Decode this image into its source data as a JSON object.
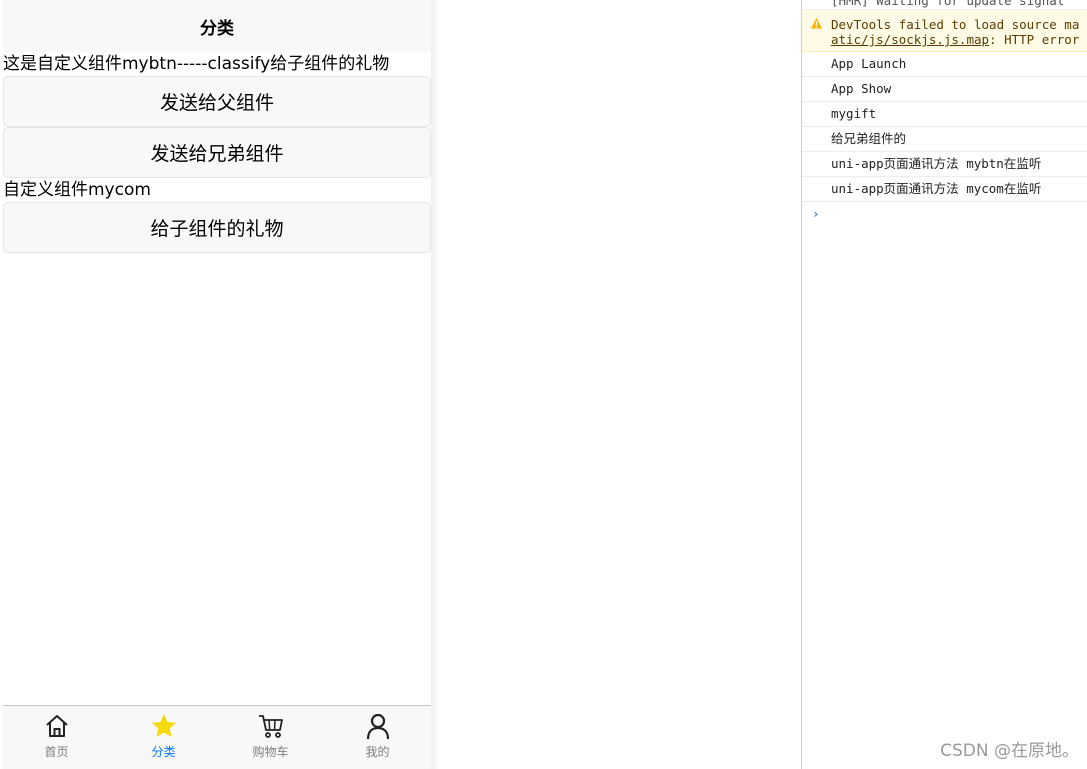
{
  "navbar": {
    "title": "分类"
  },
  "content": {
    "mybtn_text": "这是自定义组件mybtn-----classify给子组件的礼物",
    "buttons": [
      "发送给父组件",
      "发送给兄弟组件"
    ],
    "mycom_text": "自定义组件mycom",
    "gift_button": "给子组件的礼物"
  },
  "tabbar": {
    "tabs": [
      {
        "label": "首页",
        "icon": "home-icon",
        "active": false
      },
      {
        "label": "分类",
        "icon": "star-icon",
        "active": true
      },
      {
        "label": "购物车",
        "icon": "cart-icon",
        "active": false
      },
      {
        "label": "我的",
        "icon": "user-icon",
        "active": false
      }
    ],
    "active_color": "#007aff",
    "star_color": "#f5d90a"
  },
  "console": {
    "top_partial": "[HMR] Waiting for update signal",
    "warning_line1": "DevTools failed to load source ma",
    "warning_link": "atic/js/sockjs.js.map",
    "warning_rest": ": HTTP error",
    "logs": [
      "App Launch",
      "App Show",
      "mygift",
      "给兄弟组件的",
      "uni-app页面通讯方法 mybtn在监听",
      "uni-app页面通讯方法 mycom在监听"
    ],
    "prompt": "›"
  },
  "watermark": "CSDN @在原地。"
}
